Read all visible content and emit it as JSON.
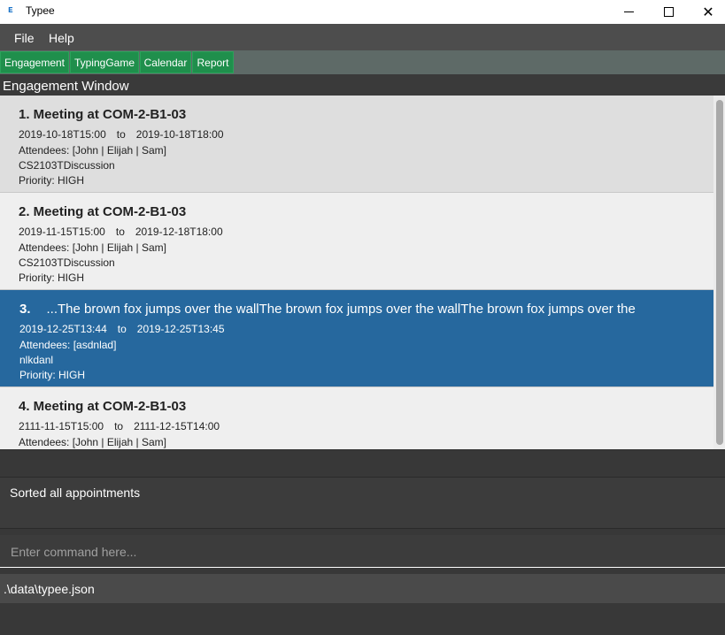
{
  "window": {
    "title": "Typee",
    "app_icon": "ᴇ"
  },
  "menu": {
    "file": "File",
    "help": "Help"
  },
  "tabs": [
    "Engagement",
    "TypingGame",
    "Calendar",
    "Report"
  ],
  "panel": {
    "title": "Engagement Window"
  },
  "engagements": [
    {
      "name": "1. Meeting at COM-2-B1-03",
      "start": "2019-10-18T15:00",
      "to": "to",
      "end": "2019-10-18T18:00",
      "attendees": "Attendees: [John | Elijah | Sam]",
      "description": "CS2103TDiscussion",
      "priority": "Priority: HIGH"
    },
    {
      "name": "2. Meeting at COM-2-B1-03",
      "start": "2019-11-15T15:00",
      "to": "to",
      "end": "2019-12-18T18:00",
      "attendees": "Attendees: [John | Elijah | Sam]",
      "description": "CS2103TDiscussion",
      "priority": "Priority: HIGH"
    },
    {
      "num": "3.",
      "name": "...The brown fox jumps over the wallThe brown fox jumps over the wallThe brown fox jumps over the",
      "start": "2019-12-25T13:44",
      "to": "to",
      "end": "2019-12-25T13:45",
      "attendees": "Attendees: [asdnlad]",
      "description": "nlkdanl",
      "priority": "Priority: HIGH"
    },
    {
      "name": "4. Meeting at COM-2-B1-03",
      "start": "2111-11-15T15:00",
      "to": "to",
      "end": "2111-12-15T14:00",
      "attendees": "Attendees: [John | Elijah | Sam]"
    }
  ],
  "result": {
    "text": "Sorted all appointments"
  },
  "command": {
    "placeholder": "Enter command here..."
  },
  "status": {
    "path": ".\\data\\typee.json"
  },
  "colors": {
    "tab_green": "#1f8f4c",
    "selected_card": "#26689e"
  }
}
